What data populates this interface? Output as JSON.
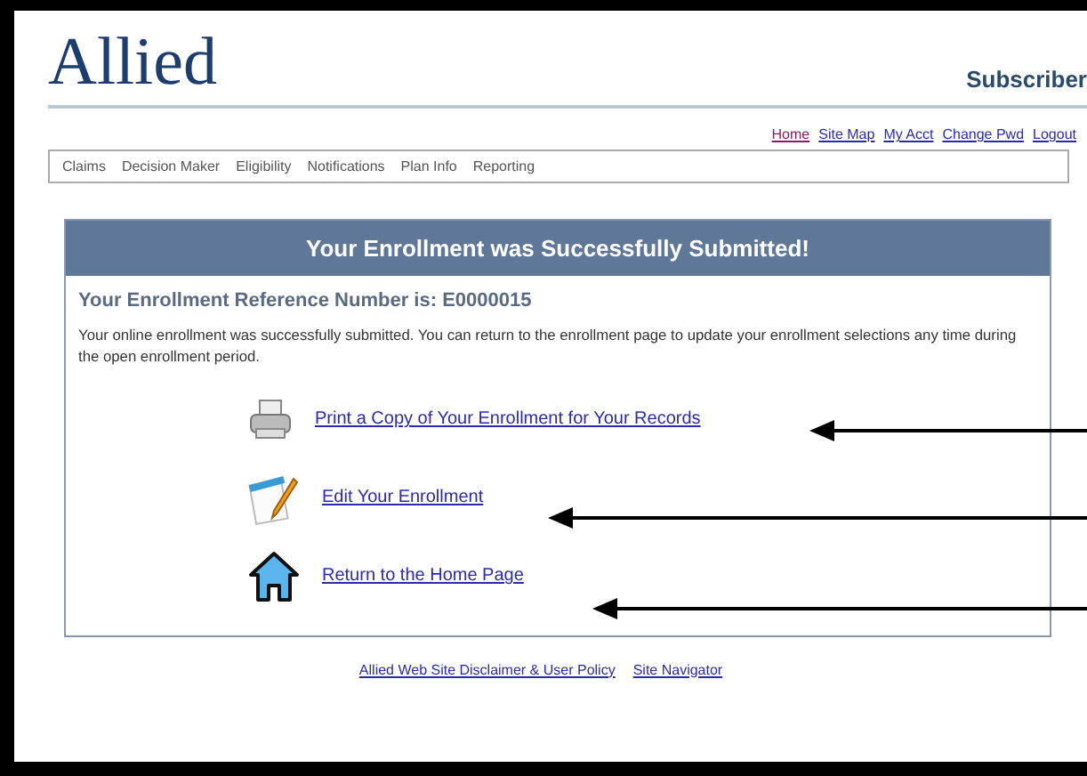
{
  "header": {
    "logo": "Allied",
    "role": "Subscriber"
  },
  "top_links": [
    {
      "label": "Home",
      "visited": true
    },
    {
      "label": "Site Map",
      "visited": false
    },
    {
      "label": "My Acct",
      "visited": false
    },
    {
      "label": "Change Pwd",
      "visited": false
    },
    {
      "label": "Logout",
      "visited": false
    }
  ],
  "menu": [
    "Claims",
    "Decision Maker",
    "Eligibility",
    "Notifications",
    "Plan Info",
    "Reporting"
  ],
  "panel": {
    "title": "Your Enrollment was Successfully Submitted!",
    "reference": "Your Enrollment Reference Number is: E0000015",
    "message": "Your online enrollment was successfully submitted. You can return to the enrollment page to update your enrollment selections any time during the open enrollment period.",
    "actions": [
      {
        "kind": "print",
        "label": "Print a Copy of Your Enrollment for Your Records",
        "arrow": true
      },
      {
        "kind": "edit",
        "label": "Edit Your Enrollment",
        "arrow": true
      },
      {
        "kind": "home",
        "label": "Return to the Home Page",
        "arrow": true
      }
    ]
  },
  "footer_links": [
    "Allied Web Site Disclaimer & User Policy",
    "Site Navigator"
  ]
}
